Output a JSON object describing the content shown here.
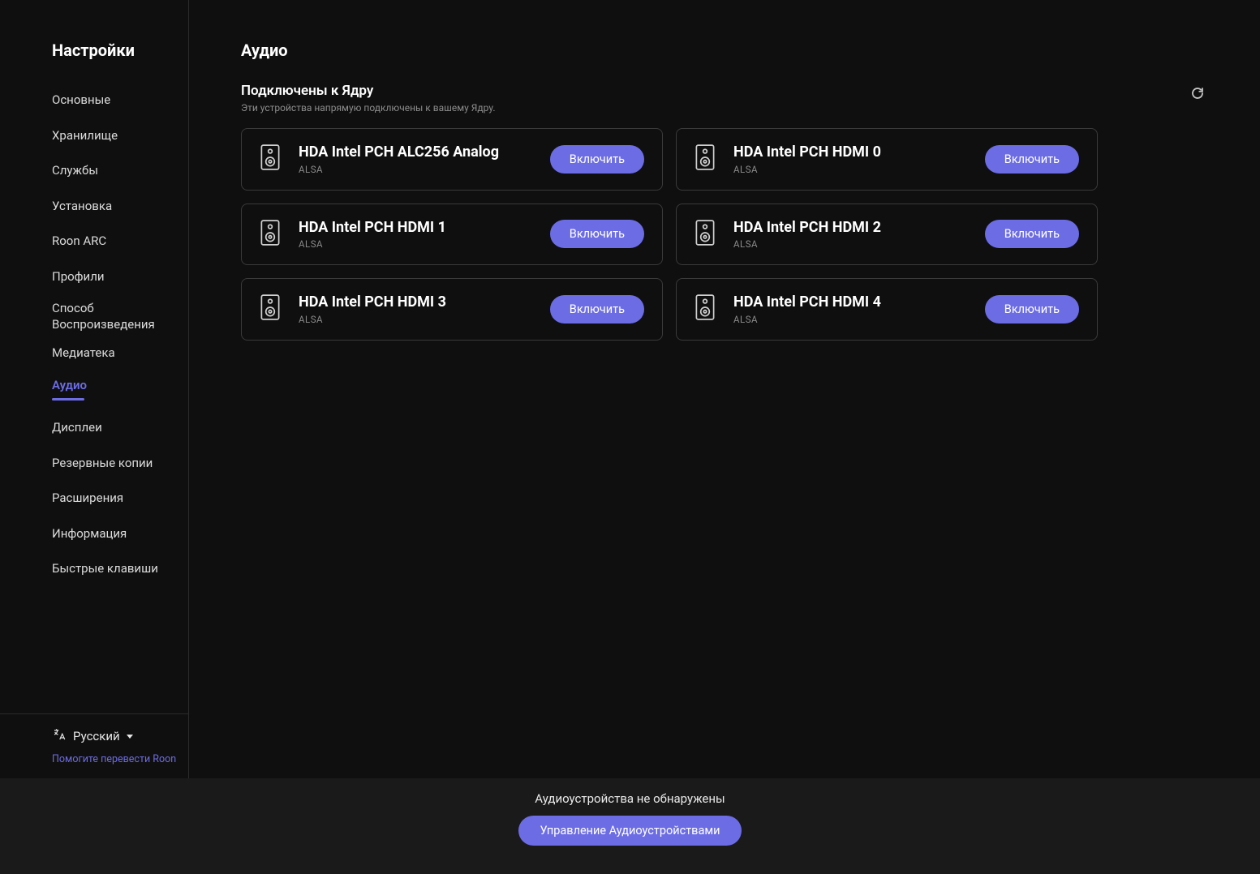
{
  "sidebar": {
    "title": "Настройки",
    "items": [
      {
        "label": "Основные",
        "key": "general"
      },
      {
        "label": "Хранилище",
        "key": "storage"
      },
      {
        "label": "Службы",
        "key": "services"
      },
      {
        "label": "Установка",
        "key": "setup"
      },
      {
        "label": "Roon ARC",
        "key": "roonarc"
      },
      {
        "label": "Профили",
        "key": "profiles"
      },
      {
        "label": "Способ Воспроизведения",
        "key": "playback"
      },
      {
        "label": "Медиатека",
        "key": "library"
      },
      {
        "label": "Аудио",
        "key": "audio",
        "active": true
      },
      {
        "label": "Дисплеи",
        "key": "displays"
      },
      {
        "label": "Резервные копии",
        "key": "backups"
      },
      {
        "label": "Расширения",
        "key": "extensions"
      },
      {
        "label": "Информация",
        "key": "about"
      },
      {
        "label": "Быстрые клавиши",
        "key": "shortcuts"
      }
    ],
    "language": "Русский",
    "help_translate": "Помогите перевести Roon"
  },
  "page": {
    "title": "Аудио",
    "section_title": "Подключены к Ядру",
    "section_sub": "Эти устройства напрямую подключены к вашему Ядру.",
    "enable_label": "Включить",
    "devices": [
      {
        "name": "HDA Intel PCH ALC256 Analog",
        "driver": "ALSA"
      },
      {
        "name": "HDA Intel PCH HDMI 0",
        "driver": "ALSA"
      },
      {
        "name": "HDA Intel PCH HDMI 1",
        "driver": "ALSA"
      },
      {
        "name": "HDA Intel PCH HDMI 2",
        "driver": "ALSA"
      },
      {
        "name": "HDA Intel PCH HDMI 3",
        "driver": "ALSA"
      },
      {
        "name": "HDA Intel PCH HDMI 4",
        "driver": "ALSA"
      }
    ]
  },
  "footer": {
    "text": "Аудиоустройства не обнаружены",
    "button": "Управление Аудиоустройствами"
  }
}
